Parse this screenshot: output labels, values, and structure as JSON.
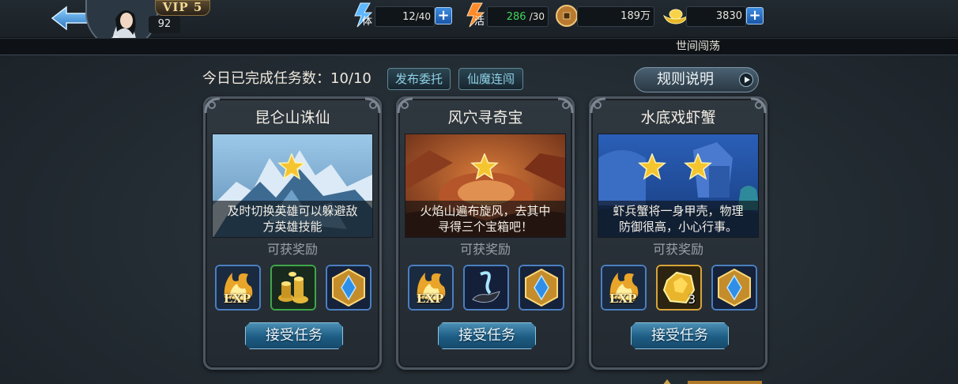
{
  "header": {
    "vip_label": "VIP 5",
    "level": "92",
    "resources": {
      "stamina": {
        "icon": "lightning-stamina-icon",
        "label": "体",
        "value": "12",
        "max": "/40"
      },
      "vitality": {
        "icon": "lightning-vitality-icon",
        "label": "活",
        "value": "286",
        "max": "/30",
        "value_color": "#3fd55a"
      },
      "coins": {
        "icon": "copper-coin-icon",
        "value": "189万"
      },
      "gold": {
        "icon": "gold-ingot-icon",
        "value": "3830"
      }
    },
    "plus_symbol": "+"
  },
  "location": {
    "name": "世间闯荡"
  },
  "tasks_header": {
    "completed_text": "今日已完成任务数：10/10",
    "publish_button": "发布委托",
    "chain_button": "仙魔连闯",
    "rules_button": "规则说明"
  },
  "reward_label": "可获奖励",
  "accept_label": "接受任务",
  "cards": [
    {
      "title": "昆仑山诛仙",
      "stars": 1,
      "desc_line1": "及时切换英雄可以躲避敌",
      "desc_line2": "方英雄技能",
      "rewards": [
        {
          "icon": "exp-reward-icon",
          "text": "EXP"
        },
        {
          "icon": "gold-coins-reward-icon"
        },
        {
          "icon": "blue-crystal-reward-icon"
        }
      ]
    },
    {
      "title": "风穴寻奇宝",
      "stars": 1,
      "desc_line1": "火焰山遍布旋风，去其中",
      "desc_line2": "寻得三个宝箱吧！",
      "rewards": [
        {
          "icon": "exp-reward-icon",
          "text": "EXP"
        },
        {
          "icon": "magic-lamp-reward-icon"
        },
        {
          "icon": "blue-crystal-reward-icon"
        }
      ]
    },
    {
      "title": "水底戏虾蟹",
      "stars": 2,
      "desc_line1": "虾兵蟹将一身甲壳，物理",
      "desc_line2": "防御很高，小心行事。",
      "rewards": [
        {
          "icon": "exp-reward-icon",
          "text": "EXP"
        },
        {
          "icon": "gold-stone-reward-icon",
          "count": "3"
        },
        {
          "icon": "blue-crystal-reward-icon"
        }
      ]
    }
  ]
}
